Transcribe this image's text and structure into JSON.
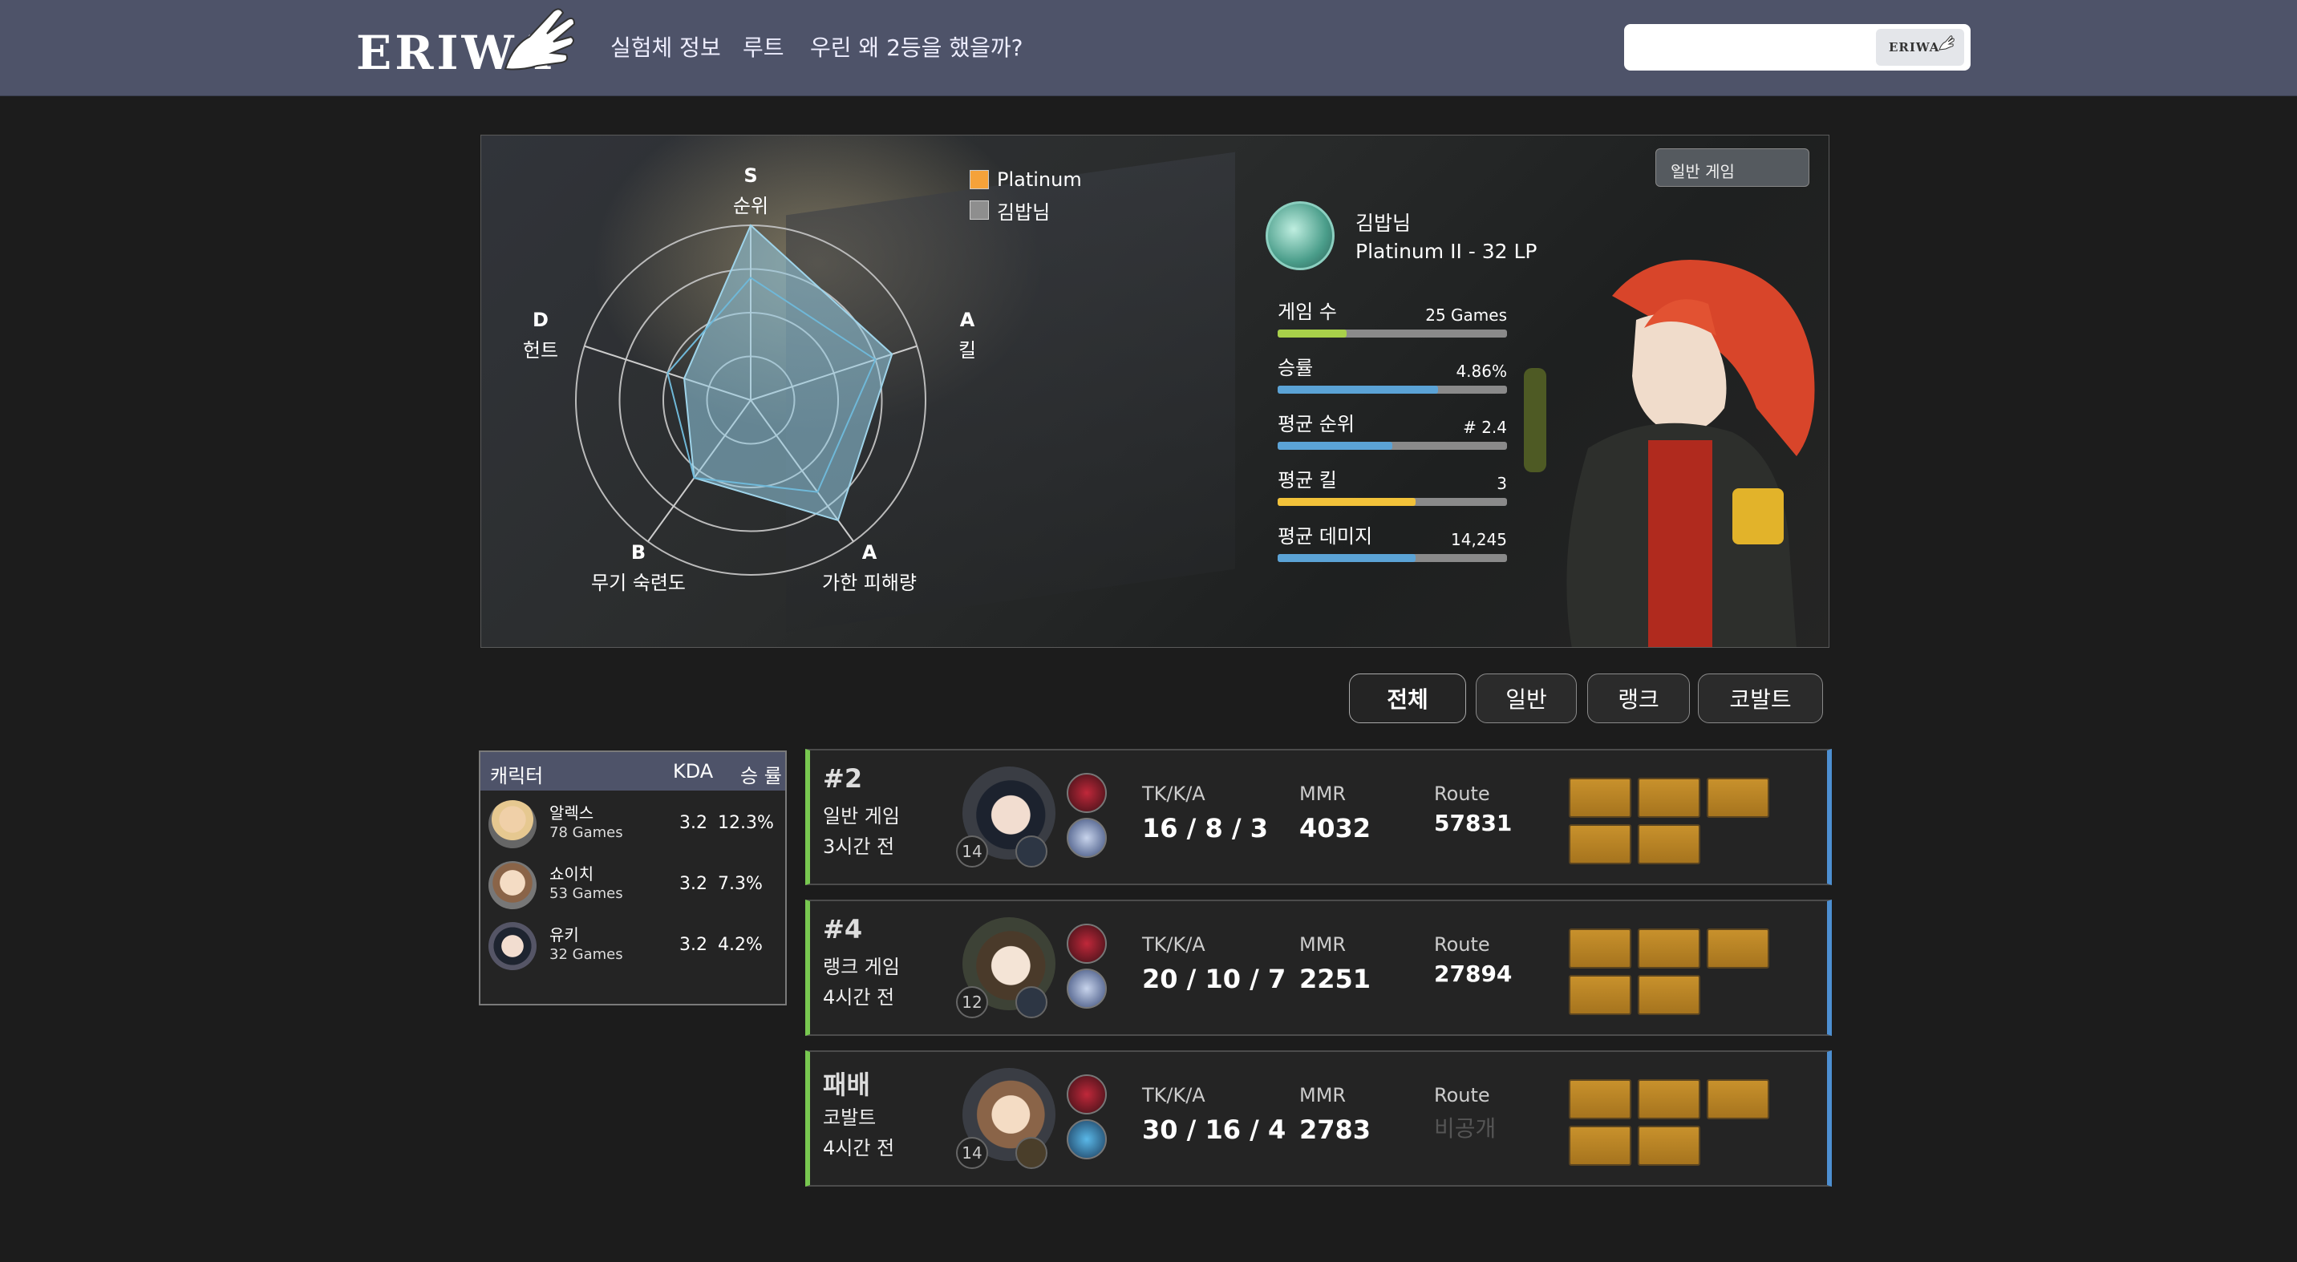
{
  "nav": {
    "logo": "ERIWA",
    "links": [
      "실험체 정보",
      "루트",
      "우린 왜 2등을 했을까?"
    ],
    "search_placeholder": "",
    "search_button": "ERIWA"
  },
  "profile": {
    "legend": [
      "Platinum",
      "김밥님"
    ],
    "mode_dropdown": "일반 게임",
    "radar_axes": [
      {
        "grade": "S",
        "label": "순위"
      },
      {
        "grade": "A",
        "label": "킬"
      },
      {
        "grade": "A",
        "label": "가한 피해량"
      },
      {
        "grade": "B",
        "label": "무기 숙련도"
      },
      {
        "grade": "D",
        "label": "헌트"
      }
    ],
    "player_name": "김밥님",
    "player_rank": "Platinum II - 32 LP",
    "stats": [
      {
        "label": "게임 수",
        "value": "25 Games",
        "fill": 0.3,
        "color": "#a8d04a"
      },
      {
        "label": "승률",
        "value": "4.86%",
        "fill": 0.7,
        "color": "#5ba3d6"
      },
      {
        "label": "평균 순위",
        "value": "# 2.4",
        "fill": 0.5,
        "color": "#5ba3d6"
      },
      {
        "label": "평균 킬",
        "value": "3",
        "fill": 0.6,
        "color": "#f2c23a"
      },
      {
        "label": "평균 데미지",
        "value": "14,245",
        "fill": 0.6,
        "color": "#5ba3d6"
      }
    ]
  },
  "filters": [
    "전체",
    "일반",
    "랭크",
    "코발트"
  ],
  "char_table": {
    "headers": {
      "character": "캐릭터",
      "kda": "KDA",
      "winrate": "승 률"
    },
    "rows": [
      {
        "name": "알렉스",
        "games": "78 Games",
        "kda": "3.2",
        "winrate": "12.3%"
      },
      {
        "name": "쇼이치",
        "games": "53 Games",
        "kda": "3.2",
        "winrate": "7.3%"
      },
      {
        "name": "유키",
        "games": "32 Games",
        "kda": "3.2",
        "winrate": "4.2%"
      }
    ]
  },
  "matches": [
    {
      "place": "#2",
      "mode": "일반 게임",
      "time": "3시간 전",
      "level": "14",
      "kda_label": "TK/K/A",
      "kda": "16 / 8 / 3",
      "mmr_label": "MMR",
      "mmr": "4032",
      "route_label": "Route",
      "route": "57831"
    },
    {
      "place": "#4",
      "mode": "랭크 게임",
      "time": "4시간 전",
      "level": "12",
      "kda_label": "TK/K/A",
      "kda": "20 / 10 / 7",
      "mmr_label": "MMR",
      "mmr": "2251",
      "route_label": "Route",
      "route": "27894"
    },
    {
      "place": "패배",
      "mode": "코발트",
      "time": "4시간 전",
      "level": "14",
      "kda_label": "TK/K/A",
      "kda": "30 / 16 / 4",
      "mmr_label": "MMR",
      "mmr": "2783",
      "route_label": "Route",
      "route": "비공개"
    }
  ],
  "colors": {
    "nav": "#4e5369",
    "platinum": "#f5a23a",
    "player": "#8e8e8e",
    "win_border": "#78c850",
    "side_border": "#4d8fd1"
  }
}
